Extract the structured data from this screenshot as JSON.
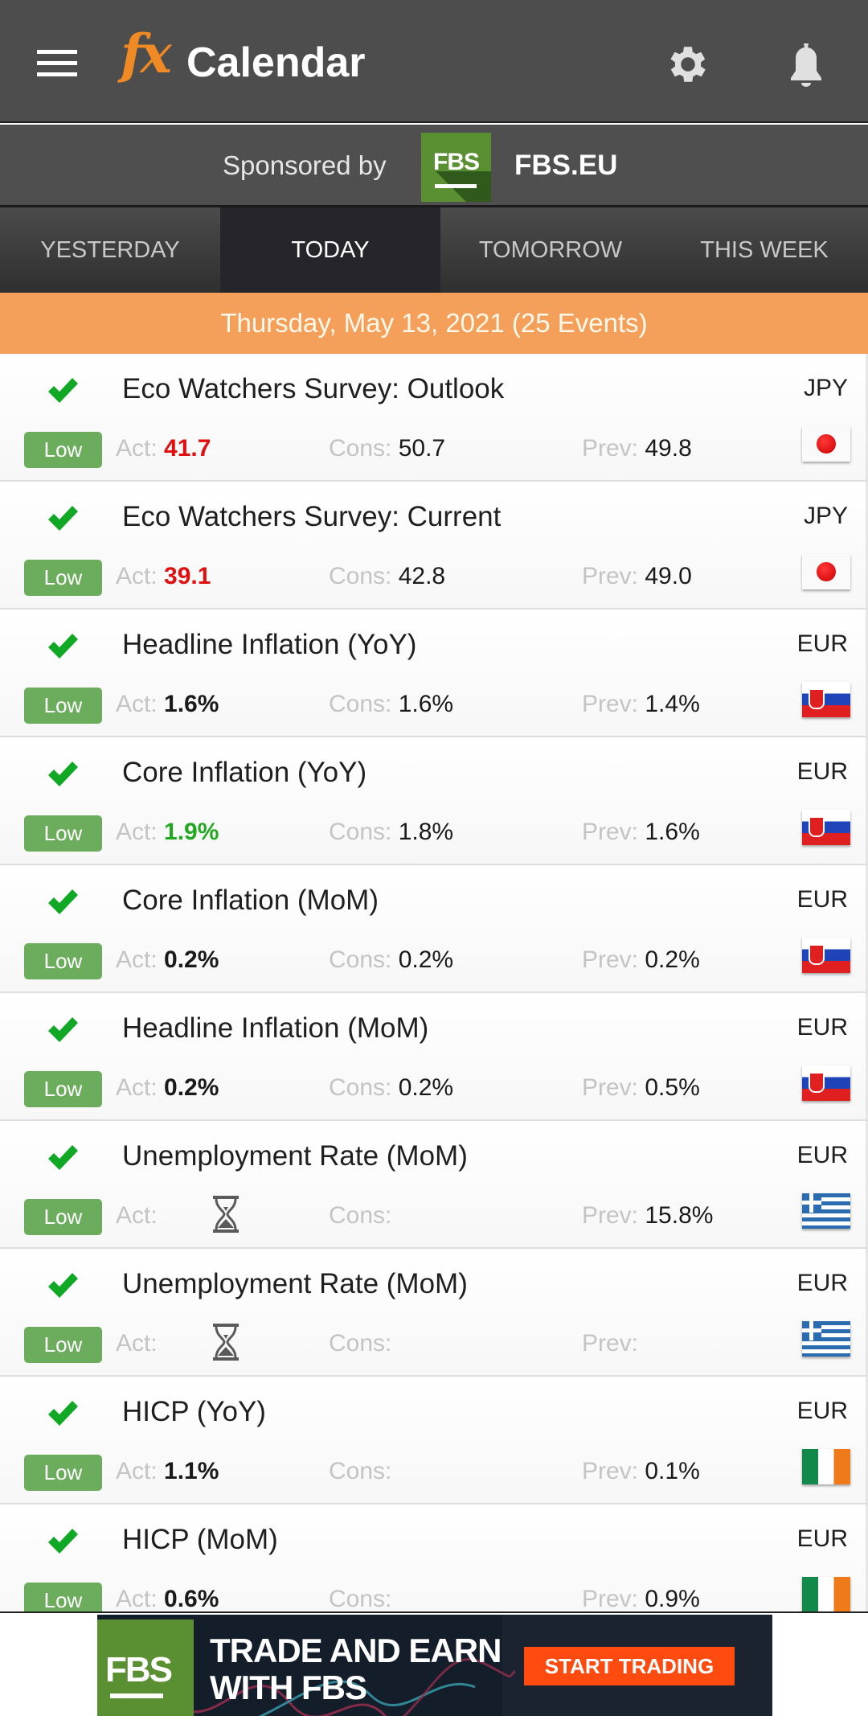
{
  "header": {
    "logo_text": "fx",
    "title": "Calendar",
    "icons": {
      "menu": "hamburger-menu-icon",
      "settings": "gear-icon",
      "notifications": "bell-icon"
    }
  },
  "sponsor": {
    "label": "Sponsored by",
    "logo_text": "FBS",
    "site": "FBS.EU"
  },
  "tabs": [
    {
      "label": "YESTERDAY",
      "active": false
    },
    {
      "label": "TODAY",
      "active": true
    },
    {
      "label": "TOMORROW",
      "active": false
    },
    {
      "label": "THIS WEEK",
      "active": false
    }
  ],
  "date_bar": "Thursday, May 13, 2021 (25 Events)",
  "labels": {
    "act": "Act:",
    "cons": "Cons:",
    "prev": "Prev:"
  },
  "colors": {
    "header_bg": "#4d4d4d",
    "accent_orange": "#f5a05a",
    "impact_low": "#6cad5d",
    "actual_worse": "#e01010",
    "actual_better": "#22a820",
    "check": "#11a826"
  },
  "events": [
    {
      "title": "Eco Watchers Survey: Outlook",
      "currency": "JPY",
      "impact": "Low",
      "actual": "41.7",
      "actual_status": "worse",
      "consensus": "50.7",
      "previous": "49.8",
      "flag": "japan",
      "pending": false
    },
    {
      "title": "Eco Watchers Survey: Current",
      "currency": "JPY",
      "impact": "Low",
      "actual": "39.1",
      "actual_status": "worse",
      "consensus": "42.8",
      "previous": "49.0",
      "flag": "japan",
      "pending": false
    },
    {
      "title": "Headline Inflation (YoY)",
      "currency": "EUR",
      "impact": "Low",
      "actual": "1.6%",
      "actual_status": "neutral",
      "consensus": "1.6%",
      "previous": "1.4%",
      "flag": "slovakia",
      "pending": false
    },
    {
      "title": "Core Inflation (YoY)",
      "currency": "EUR",
      "impact": "Low",
      "actual": "1.9%",
      "actual_status": "better",
      "consensus": "1.8%",
      "previous": "1.6%",
      "flag": "slovakia",
      "pending": false
    },
    {
      "title": "Core Inflation (MoM)",
      "currency": "EUR",
      "impact": "Low",
      "actual": "0.2%",
      "actual_status": "neutral",
      "consensus": "0.2%",
      "previous": "0.2%",
      "flag": "slovakia",
      "pending": false
    },
    {
      "title": "Headline Inflation (MoM)",
      "currency": "EUR",
      "impact": "Low",
      "actual": "0.2%",
      "actual_status": "neutral",
      "consensus": "0.2%",
      "previous": "0.5%",
      "flag": "slovakia",
      "pending": false
    },
    {
      "title": "Unemployment Rate (MoM)",
      "currency": "EUR",
      "impact": "Low",
      "actual": "",
      "actual_status": "pending",
      "consensus": "",
      "previous": "15.8%",
      "flag": "greece",
      "pending": true
    },
    {
      "title": "Unemployment Rate (MoM)",
      "currency": "EUR",
      "impact": "Low",
      "actual": "",
      "actual_status": "pending",
      "consensus": "",
      "previous": "",
      "flag": "greece",
      "pending": true
    },
    {
      "title": "HICP (YoY)",
      "currency": "EUR",
      "impact": "Low",
      "actual": "1.1%",
      "actual_status": "neutral",
      "consensus": "",
      "previous": "0.1%",
      "flag": "ireland",
      "pending": false
    },
    {
      "title": "HICP (MoM)",
      "currency": "EUR",
      "impact": "Low",
      "actual": "0.6%",
      "actual_status": "neutral",
      "consensus": "",
      "previous": "0.9%",
      "flag": "ireland",
      "pending": false
    }
  ],
  "ad": {
    "logo_text": "FBS",
    "headline_line1": "TRADE AND EARN",
    "headline_line2": "WITH FBS",
    "cta": "START TRADING"
  }
}
